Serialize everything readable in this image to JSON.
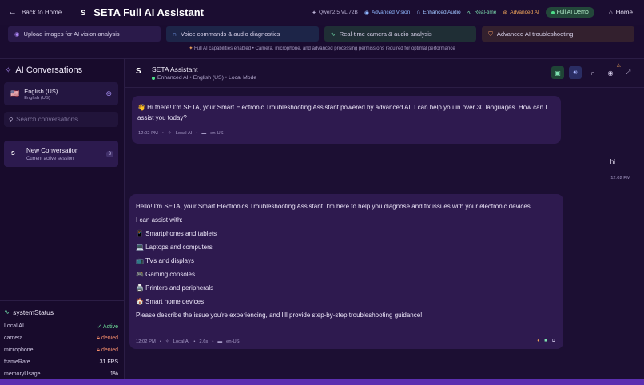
{
  "header": {
    "back_label": "Back to Home",
    "logo_letter": "S",
    "title": "SETA Full AI Assistant",
    "badges": {
      "qwen": "Qwen2.5 VL 72B",
      "vision": "Advanced Vision",
      "audio": "Enhanced Audio",
      "realtime": "Real-time",
      "advanced_ai": "Advanced AI"
    },
    "demo_label": "Full AI Demo",
    "home_label": "Home"
  },
  "features": {
    "items": [
      "Upload images for AI vision analysis",
      "Voice commands & audio diagnostics",
      "Real-time camera & audio analysis",
      "Advanced AI troubleshooting"
    ],
    "note": "Full AI capabilities enabled • Camera, microphone, and advanced processing permissions required for optimal performance"
  },
  "sidebar": {
    "title": "AI Conversations",
    "language": {
      "flag": "🇺🇸",
      "name": "English (US)",
      "sub": "English (US)"
    },
    "search_placeholder": "Search conversations...",
    "conversation": {
      "avatar": "S",
      "title": "New Conversation",
      "subtitle": "Current active session",
      "count": "3"
    },
    "system_status": {
      "title": "systemStatus",
      "rows": [
        {
          "label": "Local AI",
          "value": "✓ Active"
        },
        {
          "label": "camera",
          "value": "denied"
        },
        {
          "label": "microphone",
          "value": "denied"
        },
        {
          "label": "frameRate",
          "value": "31 FPS"
        },
        {
          "label": "memoryUsage",
          "value": "1%"
        }
      ]
    }
  },
  "chat": {
    "avatar": "S",
    "assistant_name": "SETA Assistant",
    "assistant_sub": "Enhanced AI • English (US) • Local Mode",
    "messages": {
      "first": {
        "text": "👋 Hi there! I'm SETA, your Smart Electronic Troubleshooting Assistant powered by advanced AI. I can help you in over 30 languages. How can I assist you today?",
        "time": "12:02 PM",
        "source": "Local AI",
        "lang": "en-US"
      },
      "user": {
        "text": "hi",
        "time": "12:02 PM"
      },
      "second": {
        "intro": "Hello! I'm SETA, your Smart Electronics Troubleshooting Assistant. I'm here to help you diagnose and fix issues with your electronic devices.",
        "assist": "I can assist with:",
        "list": [
          "📱 Smartphones and tablets",
          "💻 Laptops and computers",
          "📺 TVs and displays",
          "🎮 Gaming consoles",
          "🖨️ Printers and peripherals",
          "🏠 Smart home devices"
        ],
        "closing": "Please describe the issue you're experiencing, and I'll provide step-by-step troubleshooting guidance!",
        "time": "12:02 PM",
        "source": "Local AI",
        "duration": "2.6s",
        "lang": "en-US"
      }
    }
  },
  "colors": {
    "background": "#1c0f33",
    "accent_purple": "#5b2fb0",
    "active_green": "#6fe09a",
    "denied_orange": "#f08a6a"
  }
}
